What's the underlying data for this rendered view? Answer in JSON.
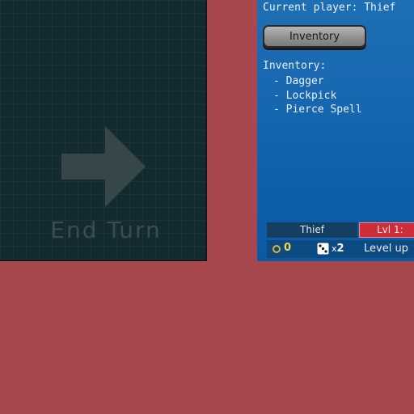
{
  "end_turn": {
    "label": "End Turn"
  },
  "player_panel": {
    "current_player": "Current player: Thief",
    "inventory_button_label": "Inventory",
    "inventory_heading": "Inventory:",
    "inventory_items": [
      "- Dagger",
      "- Lockpick",
      "- Pierce Spell"
    ],
    "class_name": "Thief",
    "level_label": "Lvl 1:",
    "coins": "0",
    "dice_prefix": "x",
    "dice_count": "2",
    "level_up_label": "Level up"
  },
  "icons": {
    "end_turn": "arrow-right-icon",
    "coin": "coin-icon",
    "die": "die-icon"
  },
  "colors": {
    "background": "#a7474e",
    "board": "#132a30",
    "panel_blue": "#1766b0",
    "level_badge": "#cf2d3a",
    "coin_text": "#f3d74a"
  }
}
